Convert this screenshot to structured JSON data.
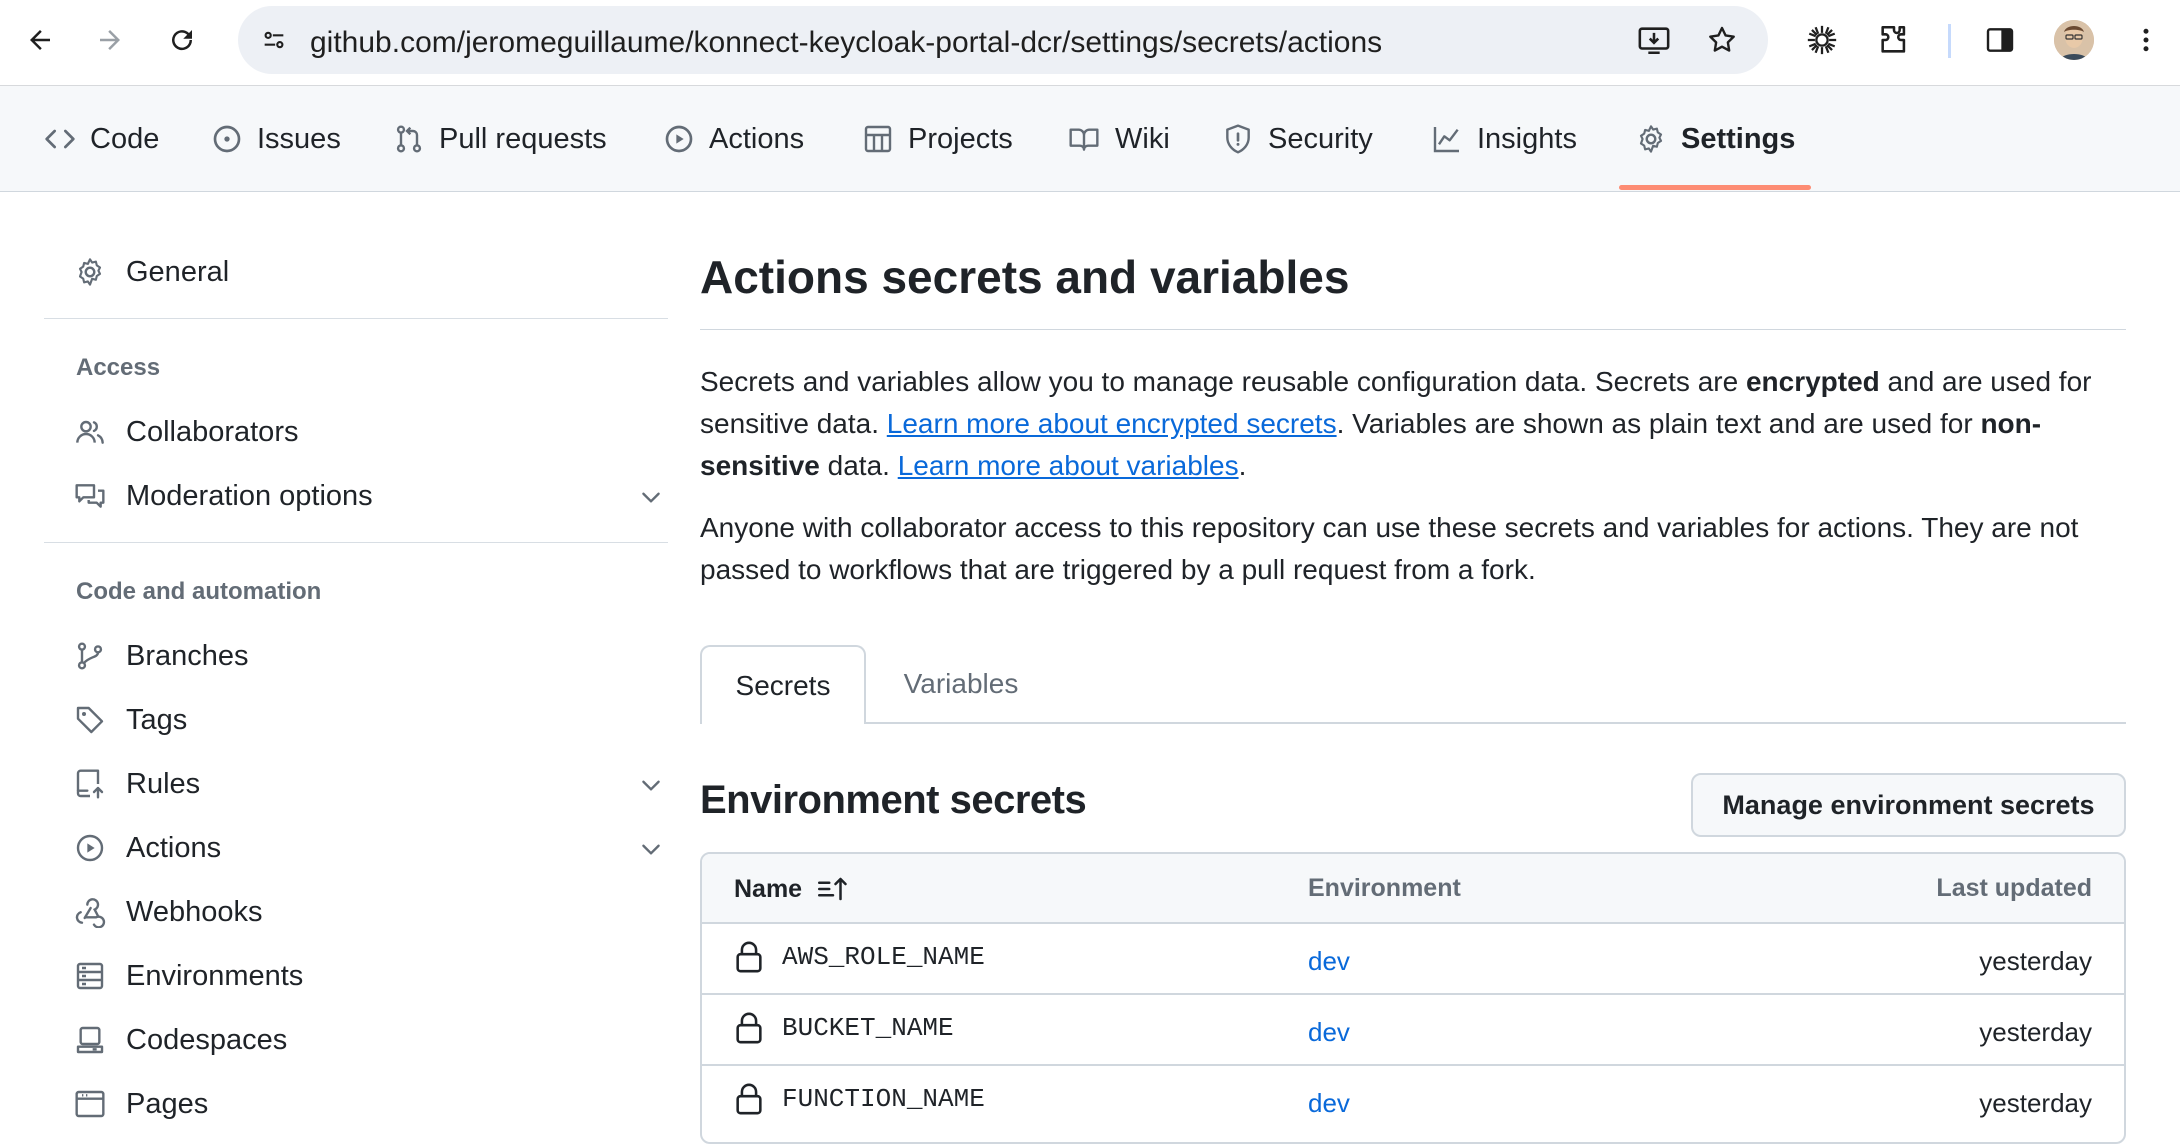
{
  "browser": {
    "url": "github.com/jeromeguillaume/konnect-keycloak-portal-dcr/settings/secrets/actions"
  },
  "repo_nav": {
    "tabs": [
      {
        "label": "Code",
        "icon": "code-icon"
      },
      {
        "label": "Issues",
        "icon": "issue-icon"
      },
      {
        "label": "Pull requests",
        "icon": "pull-request-icon"
      },
      {
        "label": "Actions",
        "icon": "play-icon"
      },
      {
        "label": "Projects",
        "icon": "table-icon"
      },
      {
        "label": "Wiki",
        "icon": "book-icon"
      },
      {
        "label": "Security",
        "icon": "shield-icon"
      },
      {
        "label": "Insights",
        "icon": "graph-icon"
      },
      {
        "label": "Settings",
        "icon": "gear-icon",
        "active": true
      }
    ],
    "accent_color": "#fd8c73"
  },
  "sidebar": {
    "general": "General",
    "access_heading": "Access",
    "collaborators": "Collaborators",
    "moderation": "Moderation options",
    "automation_heading": "Code and automation",
    "branches": "Branches",
    "tags": "Tags",
    "rules": "Rules",
    "actions": "Actions",
    "webhooks": "Webhooks",
    "environments": "Environments",
    "codespaces": "Codespaces",
    "pages": "Pages"
  },
  "main": {
    "title": "Actions secrets and variables",
    "intro": {
      "p1_part1": "Secrets and variables allow you to manage reusable configuration data. Secrets are ",
      "p1_bold1": "encrypted",
      "p1_part2": " and are used for sensitive data. ",
      "p1_link1": "Learn more about encrypted secrets",
      "p1_part3": ". Variables are shown as plain text and are used for ",
      "p1_bold2": "non-sensitive",
      "p1_part4": " data. ",
      "p1_link2": "Learn more about variables",
      "p1_part5": ".",
      "p2": "Anyone with collaborator access to this repository can use these secrets and variables for actions. They are not passed to workflows that are triggered by a pull request from a fork."
    },
    "tabs": {
      "secrets": "Secrets",
      "variables": "Variables"
    },
    "env_secrets": {
      "title": "Environment secrets",
      "manage_button": "Manage environment secrets",
      "columns": {
        "name": "Name",
        "environment": "Environment",
        "last_updated": "Last updated"
      },
      "rows": [
        {
          "name": "AWS_ROLE_NAME",
          "environment": "dev",
          "updated": "yesterday"
        },
        {
          "name": "BUCKET_NAME",
          "environment": "dev",
          "updated": "yesterday"
        },
        {
          "name": "FUNCTION_NAME",
          "environment": "dev",
          "updated": "yesterday"
        }
      ]
    }
  },
  "colors": {
    "link": "#0969da",
    "muted": "#636c76",
    "border": "#d0d7de"
  }
}
